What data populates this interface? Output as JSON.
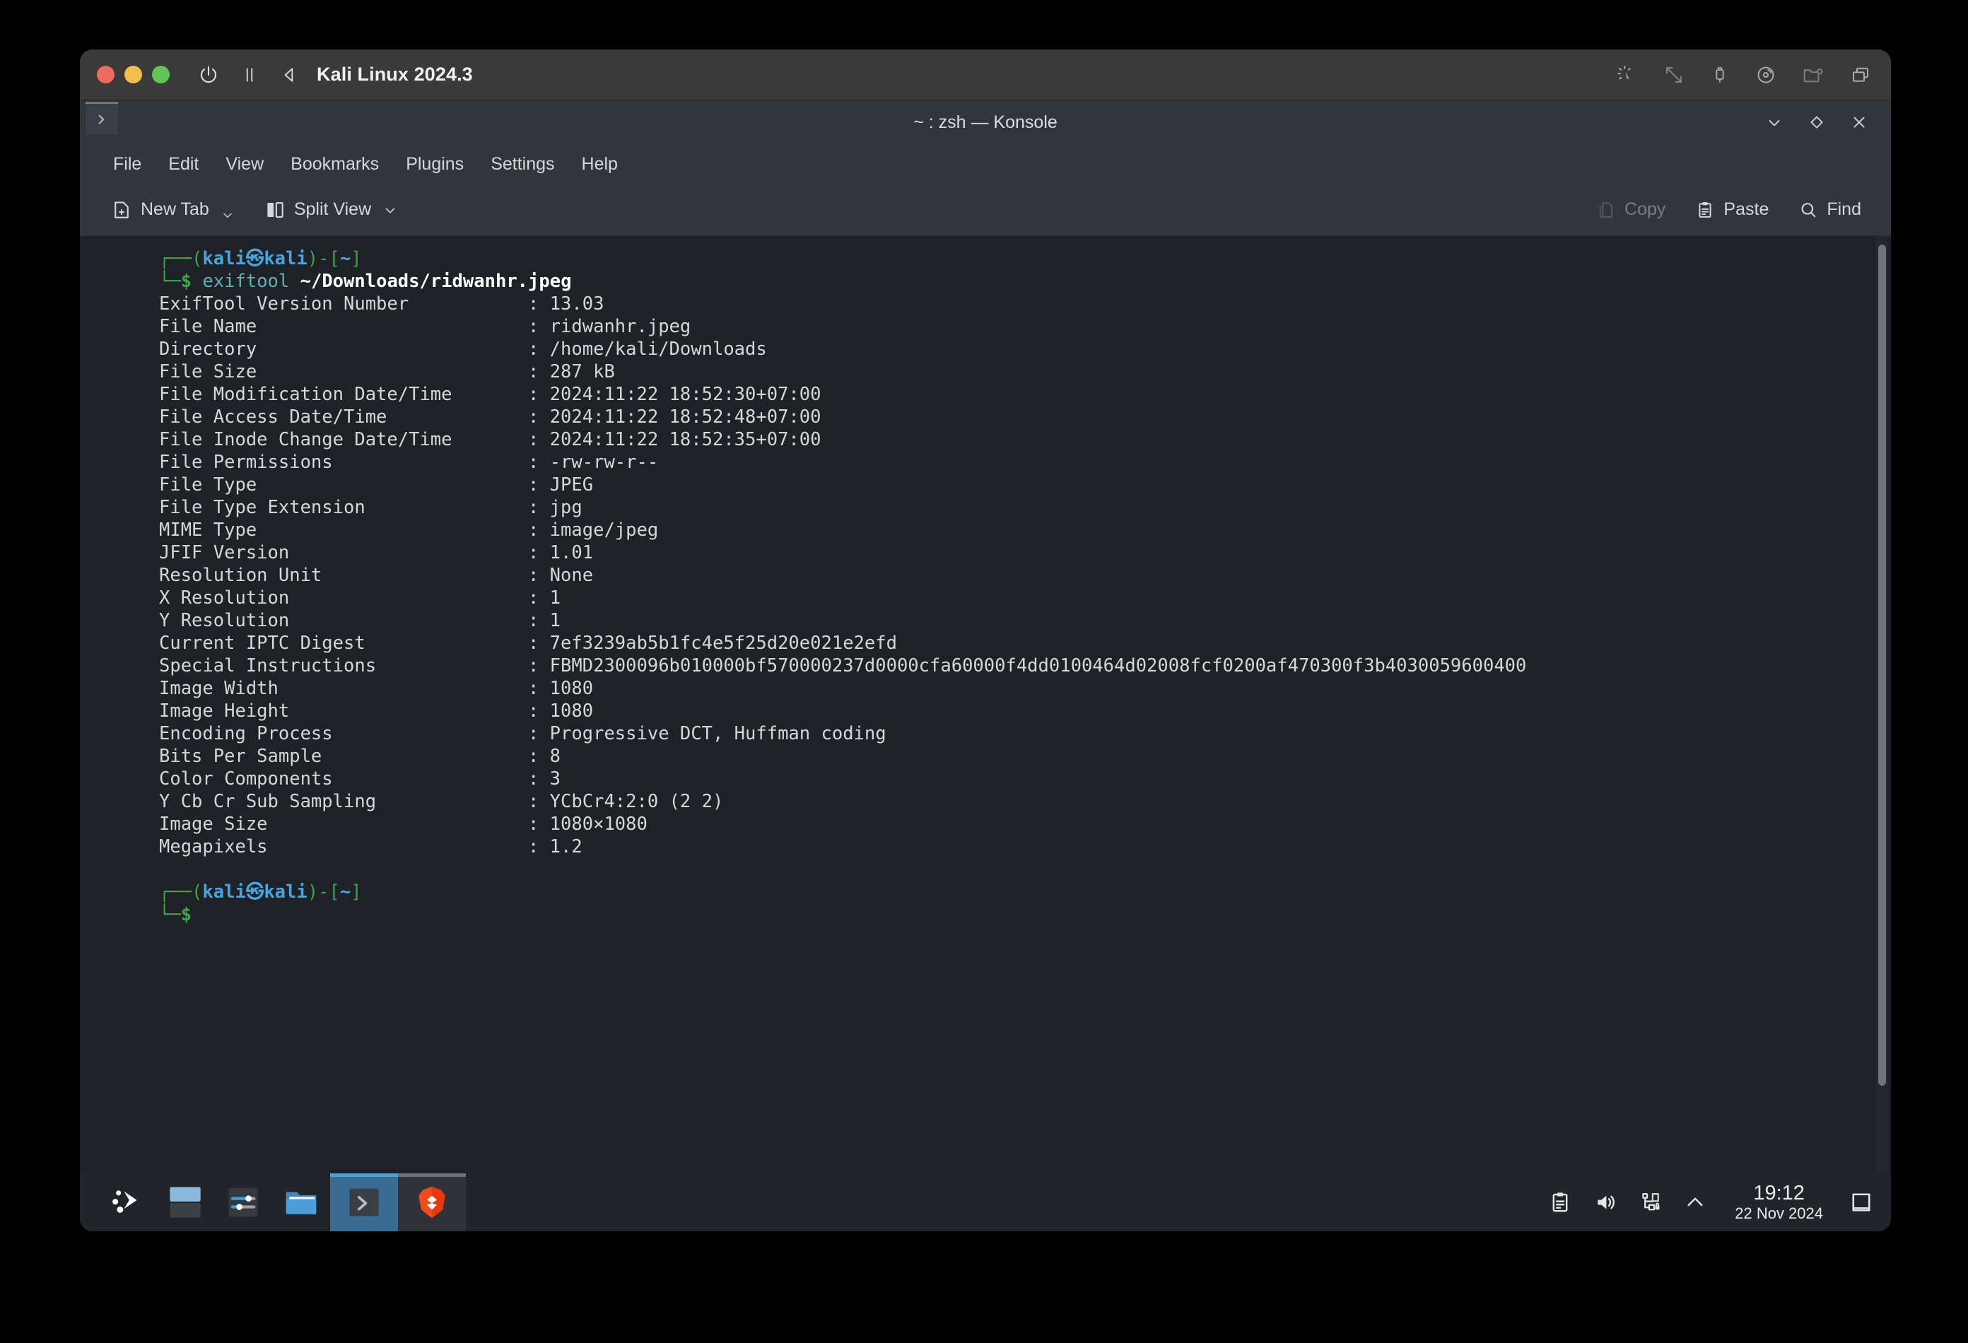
{
  "vm": {
    "title": "Kali Linux 2024.3",
    "controls": [
      "close",
      "minimize",
      "zoom"
    ],
    "left_icons": [
      "power-icon",
      "pause-icon",
      "back-icon"
    ],
    "right_icons": [
      "pointer-icon",
      "resize-icon",
      "usb-icon",
      "disc-icon",
      "shared-folder-icon",
      "windows-icon"
    ]
  },
  "konsole": {
    "title": "~ : zsh — Konsole",
    "tab_icon": "terminal-icon",
    "window_controls": [
      "minimize",
      "maximize",
      "close"
    ],
    "menus": [
      "File",
      "Edit",
      "View",
      "Bookmarks",
      "Plugins",
      "Settings",
      "Help"
    ],
    "toolbar": {
      "new_tab": "New Tab",
      "split_view": "Split View",
      "copy": "Copy",
      "paste": "Paste",
      "find": "Find"
    }
  },
  "terminal": {
    "prompt_user": "kali",
    "prompt_host": "kali",
    "prompt_path": "~",
    "command": "exiftool",
    "command_arg": "~/Downloads/ridwanhr.jpeg",
    "exif": [
      {
        "key": "ExifTool Version Number",
        "value": "13.03"
      },
      {
        "key": "File Name",
        "value": "ridwanhr.jpeg"
      },
      {
        "key": "Directory",
        "value": "/home/kali/Downloads"
      },
      {
        "key": "File Size",
        "value": "287 kB"
      },
      {
        "key": "File Modification Date/Time",
        "value": "2024:11:22 18:52:30+07:00"
      },
      {
        "key": "File Access Date/Time",
        "value": "2024:11:22 18:52:48+07:00"
      },
      {
        "key": "File Inode Change Date/Time",
        "value": "2024:11:22 18:52:35+07:00"
      },
      {
        "key": "File Permissions",
        "value": "-rw-rw-r--"
      },
      {
        "key": "File Type",
        "value": "JPEG"
      },
      {
        "key": "File Type Extension",
        "value": "jpg"
      },
      {
        "key": "MIME Type",
        "value": "image/jpeg"
      },
      {
        "key": "JFIF Version",
        "value": "1.01"
      },
      {
        "key": "Resolution Unit",
        "value": "None"
      },
      {
        "key": "X Resolution",
        "value": "1"
      },
      {
        "key": "Y Resolution",
        "value": "1"
      },
      {
        "key": "Current IPTC Digest",
        "value": "7ef3239ab5b1fc4e5f25d20e021e2efd"
      },
      {
        "key": "Special Instructions",
        "value": "FBMD2300096b010000bf570000237d0000cfa60000f4dd0100464d02008fcf0200af470300f3b4030059600400"
      },
      {
        "key": "Image Width",
        "value": "1080"
      },
      {
        "key": "Image Height",
        "value": "1080"
      },
      {
        "key": "Encoding Process",
        "value": "Progressive DCT, Huffman coding"
      },
      {
        "key": "Bits Per Sample",
        "value": "8"
      },
      {
        "key": "Color Components",
        "value": "3"
      },
      {
        "key": "Y Cb Cr Sub Sampling",
        "value": "YCbCr4:2:0 (2 2)"
      },
      {
        "key": "Image Size",
        "value": "1080×1080"
      },
      {
        "key": "Megapixels",
        "value": "1.2"
      }
    ]
  },
  "taskbar": {
    "launchers": [
      {
        "name": "kali-menu",
        "icon": "kali-dragon-icon"
      },
      {
        "name": "workspace-switcher",
        "icon": "workspace-icon"
      },
      {
        "name": "settings",
        "icon": "sliders-icon"
      },
      {
        "name": "file-manager",
        "icon": "folder-icon"
      }
    ],
    "windows": [
      {
        "name": "konsole",
        "icon": "terminal-icon",
        "active": true
      },
      {
        "name": "brave-browser",
        "icon": "brave-lion-icon",
        "active": false
      }
    ],
    "tray": [
      "clipboard-icon",
      "volume-icon",
      "network-lock-icon",
      "chevron-up-icon"
    ],
    "clock_time": "19:12",
    "clock_date": "22 Nov 2024",
    "show_desktop": "show-desktop-icon"
  },
  "colors": {
    "accent_blue": "#4a9fd8",
    "prompt_blue": "#4aa3df",
    "prompt_green": "#3fa34a",
    "cmd_teal": "#5fb3b3",
    "terminal_bg": "#1e2126",
    "chrome_bg": "#31363b"
  }
}
